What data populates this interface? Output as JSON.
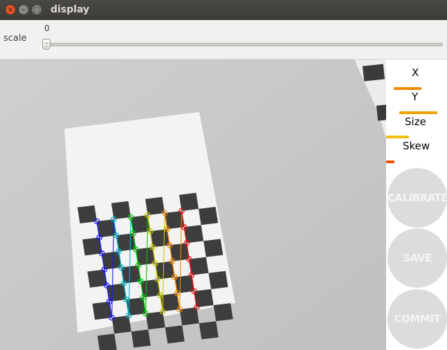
{
  "window": {
    "title": "display"
  },
  "toolbar": {
    "scale_label": "scale",
    "scale_value": "0",
    "scale_min": 0,
    "scale_position_fraction": 0
  },
  "panel": {
    "metrics": [
      {
        "label": "X",
        "color": "#f08a00",
        "level": 0.45
      },
      {
        "label": "Y",
        "color": "#f0a000",
        "level": 0.62
      },
      {
        "label": "Size",
        "color": "#f0c000",
        "level": 0.38
      },
      {
        "label": "Skew",
        "color": "#f05000",
        "level": 0.14
      }
    ],
    "buttons": {
      "calibrate": "CALIBRATE",
      "save": "SAVE",
      "commit": "COMMIT"
    }
  },
  "camera": {
    "detected_corner_colors": [
      "#1a1aff",
      "#00b4c8",
      "#00c800",
      "#c8c800",
      "#f08c00",
      "#e81010"
    ]
  }
}
